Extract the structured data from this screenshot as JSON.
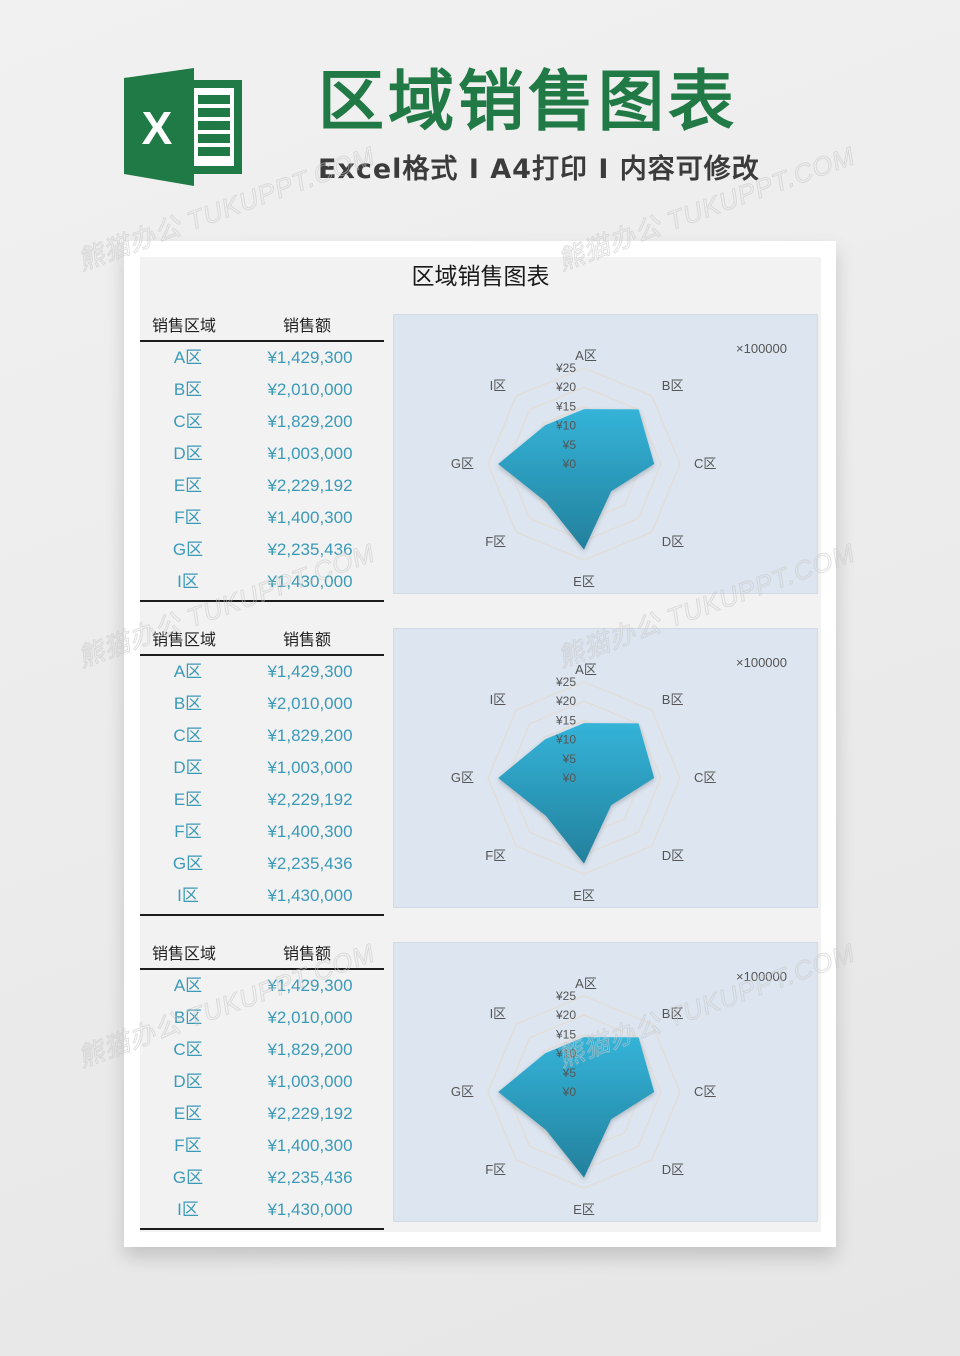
{
  "hero": {
    "title": "区域销售图表",
    "subtitle": "Excel格式 I A4打印 I 内容可修改",
    "logo_icon": "excel-logo-icon",
    "brand_color": "#217a46"
  },
  "watermark": "熊猫办公 TUKUPPT.COM",
  "sheet": {
    "title": "区域销售图表",
    "blocks": [
      {
        "table": {
          "headers": [
            "销售区域",
            "销售额"
          ],
          "rows": [
            {
              "region": "A区",
              "amount": "¥1,429,300"
            },
            {
              "region": "B区",
              "amount": "¥2,010,000"
            },
            {
              "region": "C区",
              "amount": "¥1,829,200"
            },
            {
              "region": "D区",
              "amount": "¥1,003,000"
            },
            {
              "region": "E区",
              "amount": "¥2,229,192"
            },
            {
              "region": "F区",
              "amount": "¥1,400,300"
            },
            {
              "region": "G区",
              "amount": "¥2,235,436"
            },
            {
              "region": "I区",
              "amount": "¥1,430,000"
            }
          ]
        },
        "unit_label": "×100000"
      },
      {
        "table": {
          "headers": [
            "销售区域",
            "销售额"
          ],
          "rows": [
            {
              "region": "A区",
              "amount": "¥1,429,300"
            },
            {
              "region": "B区",
              "amount": "¥2,010,000"
            },
            {
              "region": "C区",
              "amount": "¥1,829,200"
            },
            {
              "region": "D区",
              "amount": "¥1,003,000"
            },
            {
              "region": "E区",
              "amount": "¥2,229,192"
            },
            {
              "region": "F区",
              "amount": "¥1,400,300"
            },
            {
              "region": "G区",
              "amount": "¥2,235,436"
            },
            {
              "region": "I区",
              "amount": "¥1,430,000"
            }
          ]
        },
        "unit_label": "×100000"
      },
      {
        "table": {
          "headers": [
            "销售区域",
            "销售额"
          ],
          "rows": [
            {
              "region": "A区",
              "amount": "¥1,429,300"
            },
            {
              "region": "B区",
              "amount": "¥2,010,000"
            },
            {
              "region": "C区",
              "amount": "¥1,829,200"
            },
            {
              "region": "D区",
              "amount": "¥1,003,000"
            },
            {
              "region": "E区",
              "amount": "¥2,229,192"
            },
            {
              "region": "F区",
              "amount": "¥1,400,300"
            },
            {
              "region": "G区",
              "amount": "¥2,235,436"
            },
            {
              "region": "I区",
              "amount": "¥1,430,000"
            }
          ]
        },
        "unit_label": "×100000"
      }
    ]
  },
  "chart_data": [
    {
      "type": "radar",
      "title": "",
      "categories": [
        "A区",
        "B区",
        "C区",
        "D区",
        "E区",
        "F区",
        "G区",
        "I区"
      ],
      "series": [
        {
          "name": "销售额",
          "values": [
            14.293,
            20.1,
            18.292,
            10.03,
            22.29192,
            14.003,
            22.35436,
            14.3
          ]
        }
      ],
      "axis_unit": "×100000",
      "ticks": [
        "¥0",
        "¥5",
        "¥10",
        "¥15",
        "¥20",
        "¥25"
      ],
      "tick_values": [
        0,
        5,
        10,
        15,
        20,
        25
      ],
      "range": [
        0,
        25
      ],
      "colors": {
        "fill_top": "#34b3d8",
        "fill_bottom": "#23809c",
        "grid": "#e4dcd4",
        "background": "#dce5f0"
      }
    },
    {
      "type": "radar",
      "title": "",
      "categories": [
        "A区",
        "B区",
        "C区",
        "D区",
        "E区",
        "F区",
        "G区",
        "I区"
      ],
      "series": [
        {
          "name": "销售额",
          "values": [
            14.293,
            20.1,
            18.292,
            10.03,
            22.29192,
            14.003,
            22.35436,
            14.3
          ]
        }
      ],
      "axis_unit": "×100000",
      "ticks": [
        "¥0",
        "¥5",
        "¥10",
        "¥15",
        "¥20",
        "¥25"
      ],
      "tick_values": [
        0,
        5,
        10,
        15,
        20,
        25
      ],
      "range": [
        0,
        25
      ],
      "colors": {
        "fill_top": "#34b3d8",
        "fill_bottom": "#23809c",
        "grid": "#e4dcd4",
        "background": "#dce5f0"
      }
    },
    {
      "type": "radar",
      "title": "",
      "categories": [
        "A区",
        "B区",
        "C区",
        "D区",
        "E区",
        "F区",
        "G区",
        "I区"
      ],
      "series": [
        {
          "name": "销售额",
          "values": [
            14.293,
            20.1,
            18.292,
            10.03,
            22.29192,
            14.003,
            22.35436,
            14.3
          ]
        }
      ],
      "axis_unit": "×100000",
      "ticks": [
        "¥0",
        "¥5",
        "¥10",
        "¥15",
        "¥20",
        "¥25"
      ],
      "tick_values": [
        0,
        5,
        10,
        15,
        20,
        25
      ],
      "range": [
        0,
        25
      ],
      "colors": {
        "fill_top": "#34b3d8",
        "fill_bottom": "#23809c",
        "grid": "#e4dcd4",
        "background": "#dce5f0"
      }
    }
  ]
}
